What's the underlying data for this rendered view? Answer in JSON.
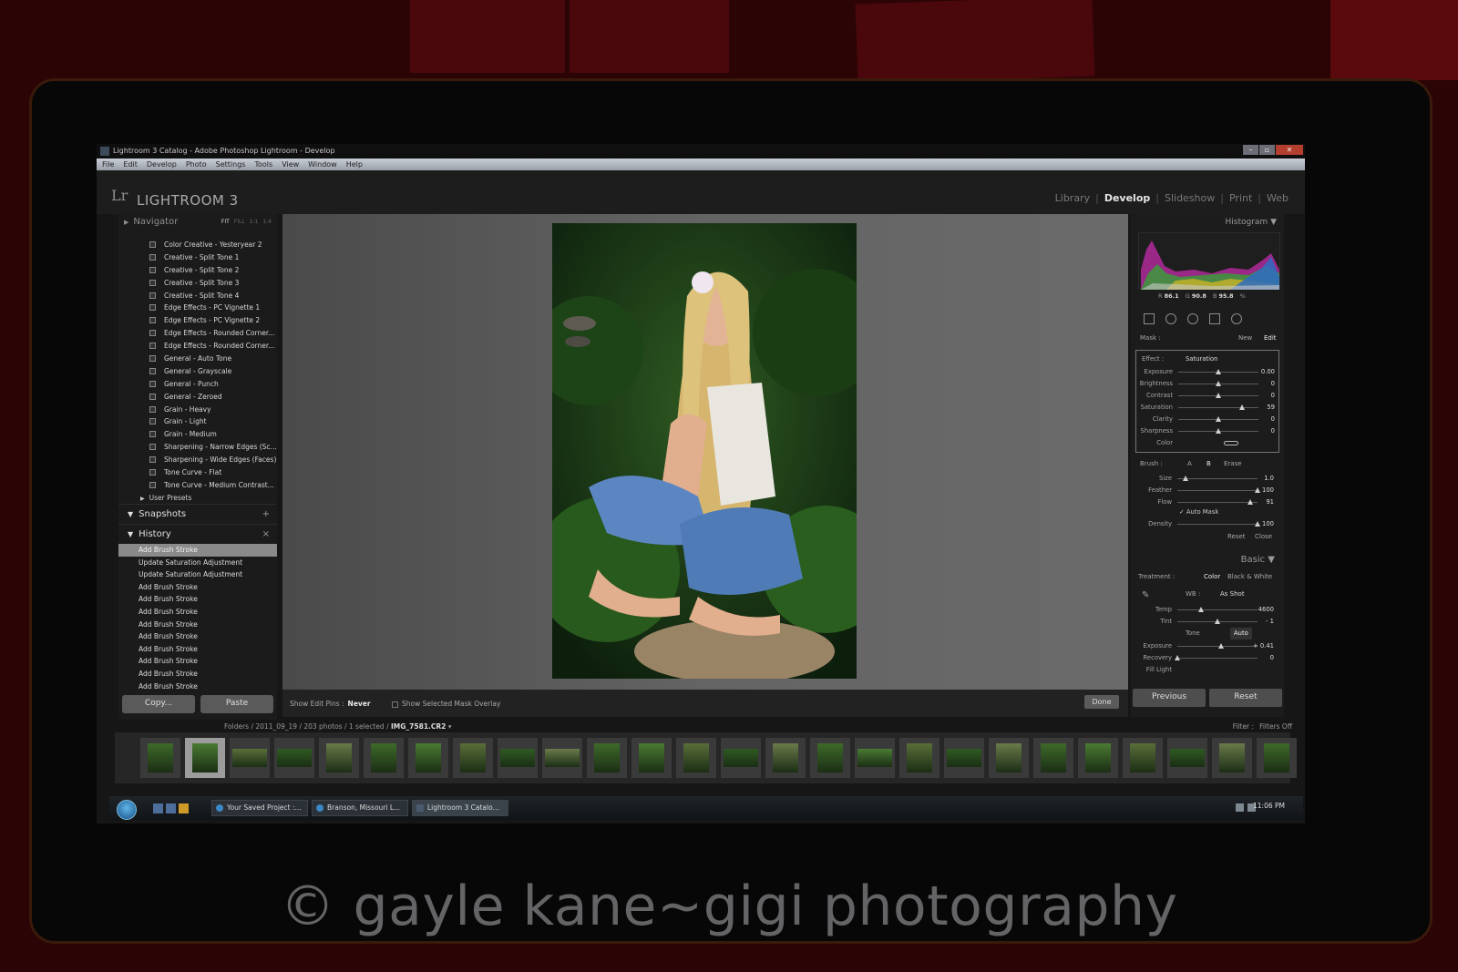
{
  "window": {
    "title": "Lightroom 3 Catalog - Adobe Photoshop Lightroom - Develop",
    "menu": [
      "File",
      "Edit",
      "Develop",
      "Photo",
      "Settings",
      "Tools",
      "View",
      "Window",
      "Help"
    ]
  },
  "app": {
    "logo": "Lr",
    "name": "LIGHTROOM 3",
    "modules": [
      "Library",
      "Develop",
      "Slideshow",
      "Print",
      "Web"
    ],
    "active_module": "Develop"
  },
  "left_panel": {
    "navigator": "Navigator",
    "zoom_options": [
      "FIT",
      "FILL",
      "1:1",
      "1:4"
    ],
    "presets": [
      "Color Creative - Yesteryear 2",
      "Creative - Split Tone 1",
      "Creative - Split Tone 2",
      "Creative - Split Tone 3",
      "Creative - Split Tone 4",
      "Edge Effects - PC Vignette 1",
      "Edge Effects - PC Vignette 2",
      "Edge Effects - Rounded Corner...",
      "Edge Effects - Rounded Corner...",
      "General - Auto Tone",
      "General - Grayscale",
      "General - Punch",
      "General - Zeroed",
      "Grain - Heavy",
      "Grain - Light",
      "Grain - Medium",
      "Sharpening - Narrow Edges (Sc...",
      "Sharpening - Wide Edges (Faces)",
      "Tone Curve - Flat",
      "Tone Curve - Medium Contrast..."
    ],
    "user_presets": "User Presets",
    "snapshots": "Snapshots",
    "snapshots_action": "+",
    "history": "History",
    "history_action": "×",
    "history_items": [
      "Add Brush Stroke",
      "Update Saturation Adjustment",
      "Update Saturation Adjustment",
      "Add Brush Stroke",
      "Add Brush Stroke",
      "Add Brush Stroke",
      "Add Brush Stroke",
      "Add Brush Stroke",
      "Add Brush Stroke",
      "Add Brush Stroke",
      "Add Brush Stroke",
      "Add Brush Stroke"
    ],
    "copy": "Copy...",
    "paste": "Paste"
  },
  "toolbar": {
    "show_edit_pins": "Show Edit Pins :",
    "pins_value": "Never",
    "mask_overlay": "Show Selected Mask Overlay",
    "done": "Done"
  },
  "right_panel": {
    "histogram": "Histogram",
    "r": "R",
    "r_val": "86.1",
    "g": "G",
    "g_val": "90.8",
    "b": "B",
    "b_val": "95.8",
    "pct": "%",
    "mask": "Mask :",
    "new": "New",
    "edit": "Edit",
    "effect": "Effect :",
    "effect_value": "Saturation",
    "effect_sliders": [
      {
        "label": "Exposure",
        "value": "0.00",
        "pos": 0.5
      },
      {
        "label": "Brightness",
        "value": "0",
        "pos": 0.5
      },
      {
        "label": "Contrast",
        "value": "0",
        "pos": 0.5
      },
      {
        "label": "Saturation",
        "value": "59",
        "pos": 0.8
      },
      {
        "label": "Clarity",
        "value": "0",
        "pos": 0.5
      },
      {
        "label": "Sharpness",
        "value": "0",
        "pos": 0.5
      }
    ],
    "color": "Color",
    "brush": "Brush :",
    "brush_a": "A",
    "brush_b": "B",
    "erase": "Erase",
    "brush_sliders": [
      {
        "label": "Size",
        "value": "1.0",
        "pos": 0.1
      },
      {
        "label": "Feather",
        "value": "100",
        "pos": 1.0
      },
      {
        "label": "Flow",
        "value": "91",
        "pos": 0.91
      }
    ],
    "auto_mask": "Auto Mask",
    "density": {
      "label": "Density",
      "value": "100",
      "pos": 1.0
    },
    "reset": "Reset",
    "close": "Close",
    "basic": "Basic",
    "treatment": "Treatment :",
    "color_opt": "Color",
    "bw_opt": "Black & White",
    "wb": "WB :",
    "wb_value": "As Shot",
    "basic_sliders": [
      {
        "label": "Temp",
        "value": "4600",
        "pos": 0.3
      },
      {
        "label": "Tint",
        "value": "- 1",
        "pos": 0.5
      }
    ],
    "tone": "Tone",
    "auto": "Auto",
    "tone_sliders": [
      {
        "label": "Exposure",
        "value": "+ 0.41",
        "pos": 0.55
      },
      {
        "label": "Recovery",
        "value": "0",
        "pos": 0.0
      }
    ],
    "fill_light": "Fill Light",
    "previous": "Previous",
    "reset_btn": "Reset"
  },
  "filmstrip": {
    "breadcrumb": "Folders / 2011_09_19 / 203 photos / 1 selected /",
    "file": "IMG_7581.CR2",
    "filter_label": "Filter :",
    "filter_value": "Filters Off",
    "thumb_count": 26,
    "selected_index": 1
  },
  "taskbar": {
    "tasks": [
      "Your Saved Project :...",
      "Branson, Missouri L...",
      "Lightroom 3 Catalo..."
    ],
    "active_task": 2,
    "clock": "11:06 PM"
  },
  "watermark": "© gayle kane~gigi photography"
}
